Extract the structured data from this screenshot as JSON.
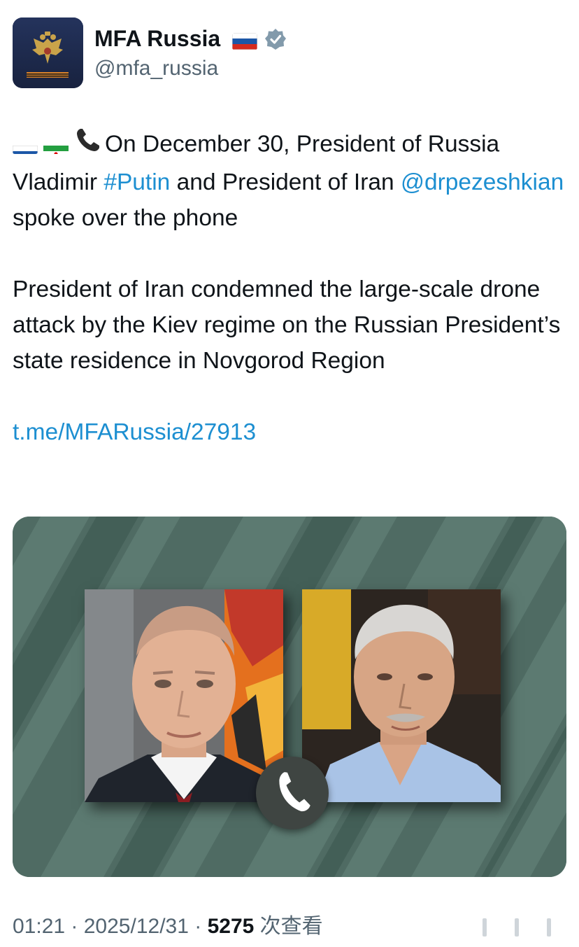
{
  "header": {
    "display_name": "MFA Russia",
    "handle": "@mfa_russia",
    "flag_icon": "russia-flag-icon",
    "verified_icon": "verified-badge-icon",
    "verified_color": "#829aab"
  },
  "tweet": {
    "line1_flags": [
      "russia-flag-icon",
      "iran-flag-icon",
      "telephone-icon"
    ],
    "p1_text_a": "On December 30, President of Russia Vladimir ",
    "p1_hashtag": "#Putin",
    "p1_text_b": " and President of Iran ",
    "p1_mention": "@drpezeshkian",
    "p1_text_c": " spoke over the phone",
    "p2_text": "President of Iran condemned the large-scale drone attack by the Kiev regime on the Russian President’s state residence in Novgorod Region",
    "link": "t.me/MFARussia/27913",
    "link_color": "#1d8fd1"
  },
  "media": {
    "left_portrait": "portrait-vladimir-putin",
    "right_portrait": "portrait-masoud-pezeshkian",
    "call_icon": "phone-handset-icon",
    "background_color": "#4f6b63"
  },
  "footer": {
    "time": "01:21",
    "separator": " · ",
    "date": "2025/12/31",
    "views_count": "5275",
    "views_label": " 次查看"
  }
}
